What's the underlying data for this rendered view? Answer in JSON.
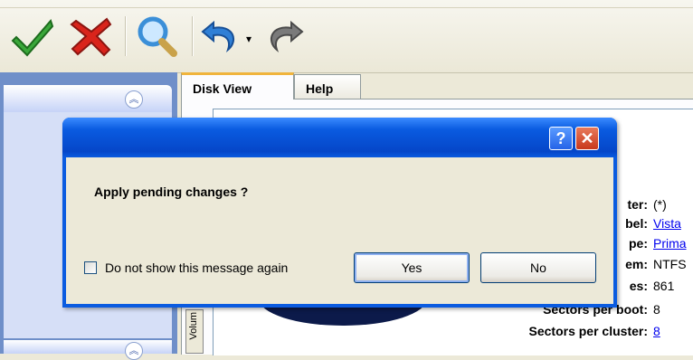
{
  "toolbar": {
    "buttons": [
      {
        "name": "apply-check-icon",
        "color": "#3aa83a"
      },
      {
        "name": "cancel-x-icon",
        "color": "#d9241b"
      },
      {
        "name": "search-magnifier-icon",
        "color": "#3b8fd8"
      },
      {
        "name": "undo-icon",
        "color": "#2f7fd6"
      },
      {
        "name": "redo-icon",
        "color": "#6e6e6e"
      }
    ]
  },
  "tabs": [
    {
      "label": "Disk View",
      "active": true
    },
    {
      "label": "Help",
      "active": false
    }
  ],
  "properties": [
    {
      "label": "ter:",
      "value": "(*)",
      "link": false
    },
    {
      "label": "bel:",
      "value": "Vista",
      "link": true
    },
    {
      "label": "pe:",
      "value": "Prima",
      "link": true
    },
    {
      "label": "em:",
      "value": "NTFS",
      "link": false
    },
    {
      "label": "es:",
      "value": "861",
      "link": false
    },
    {
      "label": "Sectors per boot:",
      "value": "8",
      "link": false
    },
    {
      "label": "Sectors per cluster:",
      "value": "8",
      "link": true
    }
  ],
  "volume_label": "Volum",
  "dialog": {
    "help_label": "?",
    "close_label": "✕",
    "message": "Apply pending changes ?",
    "checkbox_label": "Do not show this message again",
    "checkbox_checked": false,
    "yes_label": "Yes",
    "no_label": "No"
  },
  "colors": {
    "titlebar": "#0a5be0",
    "dialog_bg": "#ece9d8",
    "panel_blue": "#6f8fc9"
  }
}
